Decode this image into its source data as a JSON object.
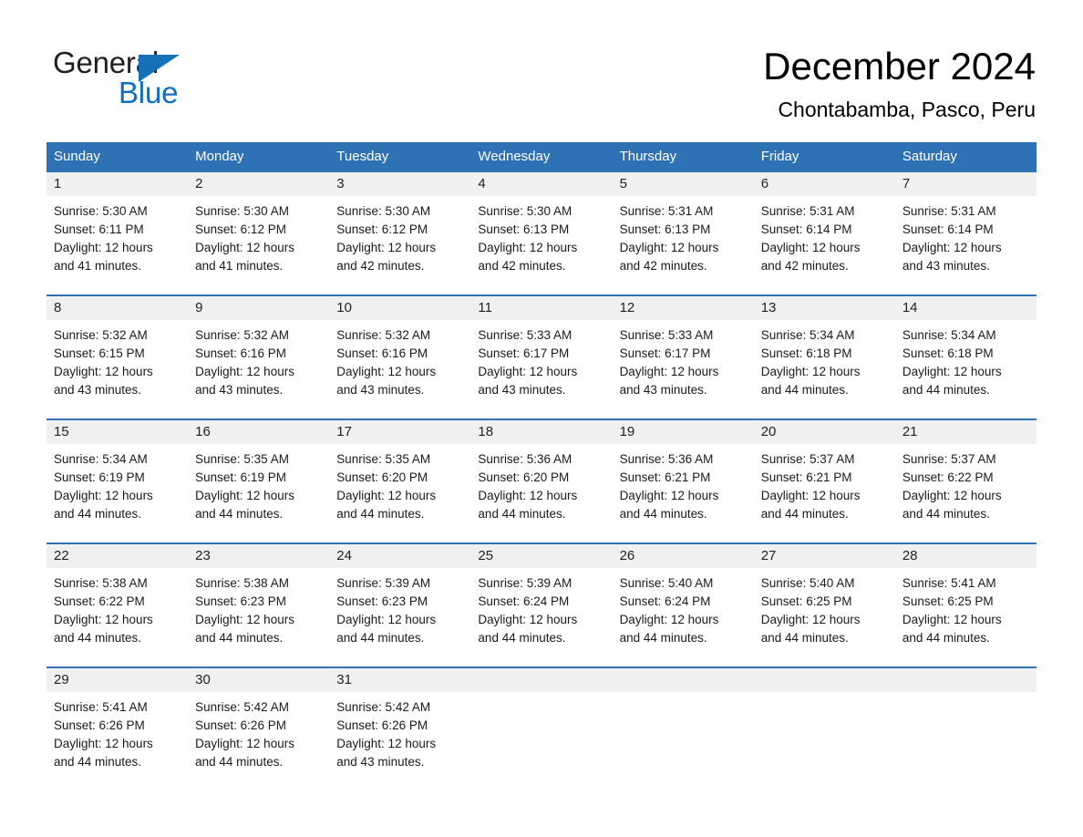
{
  "brand": {
    "name_part1": "General",
    "name_part2": "Blue",
    "triangle_color": "#1570b8",
    "blue_color": "#0f6fc0"
  },
  "header": {
    "title": "December 2024",
    "subtitle": "Chontabamba, Pasco, Peru"
  },
  "theme": {
    "header_blue": "#2e72b5",
    "daynum_gray": "#f0f0f0"
  },
  "weekdays": [
    "Sunday",
    "Monday",
    "Tuesday",
    "Wednesday",
    "Thursday",
    "Friday",
    "Saturday"
  ],
  "weeks": [
    [
      {
        "day": "1",
        "sunrise": "Sunrise: 5:30 AM",
        "sunset": "Sunset: 6:11 PM",
        "daylight_line1": "Daylight: 12 hours",
        "daylight_line2": "and 41 minutes."
      },
      {
        "day": "2",
        "sunrise": "Sunrise: 5:30 AM",
        "sunset": "Sunset: 6:12 PM",
        "daylight_line1": "Daylight: 12 hours",
        "daylight_line2": "and 41 minutes."
      },
      {
        "day": "3",
        "sunrise": "Sunrise: 5:30 AM",
        "sunset": "Sunset: 6:12 PM",
        "daylight_line1": "Daylight: 12 hours",
        "daylight_line2": "and 42 minutes."
      },
      {
        "day": "4",
        "sunrise": "Sunrise: 5:30 AM",
        "sunset": "Sunset: 6:13 PM",
        "daylight_line1": "Daylight: 12 hours",
        "daylight_line2": "and 42 minutes."
      },
      {
        "day": "5",
        "sunrise": "Sunrise: 5:31 AM",
        "sunset": "Sunset: 6:13 PM",
        "daylight_line1": "Daylight: 12 hours",
        "daylight_line2": "and 42 minutes."
      },
      {
        "day": "6",
        "sunrise": "Sunrise: 5:31 AM",
        "sunset": "Sunset: 6:14 PM",
        "daylight_line1": "Daylight: 12 hours",
        "daylight_line2": "and 42 minutes."
      },
      {
        "day": "7",
        "sunrise": "Sunrise: 5:31 AM",
        "sunset": "Sunset: 6:14 PM",
        "daylight_line1": "Daylight: 12 hours",
        "daylight_line2": "and 43 minutes."
      }
    ],
    [
      {
        "day": "8",
        "sunrise": "Sunrise: 5:32 AM",
        "sunset": "Sunset: 6:15 PM",
        "daylight_line1": "Daylight: 12 hours",
        "daylight_line2": "and 43 minutes."
      },
      {
        "day": "9",
        "sunrise": "Sunrise: 5:32 AM",
        "sunset": "Sunset: 6:16 PM",
        "daylight_line1": "Daylight: 12 hours",
        "daylight_line2": "and 43 minutes."
      },
      {
        "day": "10",
        "sunrise": "Sunrise: 5:32 AM",
        "sunset": "Sunset: 6:16 PM",
        "daylight_line1": "Daylight: 12 hours",
        "daylight_line2": "and 43 minutes."
      },
      {
        "day": "11",
        "sunrise": "Sunrise: 5:33 AM",
        "sunset": "Sunset: 6:17 PM",
        "daylight_line1": "Daylight: 12 hours",
        "daylight_line2": "and 43 minutes."
      },
      {
        "day": "12",
        "sunrise": "Sunrise: 5:33 AM",
        "sunset": "Sunset: 6:17 PM",
        "daylight_line1": "Daylight: 12 hours",
        "daylight_line2": "and 43 minutes."
      },
      {
        "day": "13",
        "sunrise": "Sunrise: 5:34 AM",
        "sunset": "Sunset: 6:18 PM",
        "daylight_line1": "Daylight: 12 hours",
        "daylight_line2": "and 44 minutes."
      },
      {
        "day": "14",
        "sunrise": "Sunrise: 5:34 AM",
        "sunset": "Sunset: 6:18 PM",
        "daylight_line1": "Daylight: 12 hours",
        "daylight_line2": "and 44 minutes."
      }
    ],
    [
      {
        "day": "15",
        "sunrise": "Sunrise: 5:34 AM",
        "sunset": "Sunset: 6:19 PM",
        "daylight_line1": "Daylight: 12 hours",
        "daylight_line2": "and 44 minutes."
      },
      {
        "day": "16",
        "sunrise": "Sunrise: 5:35 AM",
        "sunset": "Sunset: 6:19 PM",
        "daylight_line1": "Daylight: 12 hours",
        "daylight_line2": "and 44 minutes."
      },
      {
        "day": "17",
        "sunrise": "Sunrise: 5:35 AM",
        "sunset": "Sunset: 6:20 PM",
        "daylight_line1": "Daylight: 12 hours",
        "daylight_line2": "and 44 minutes."
      },
      {
        "day": "18",
        "sunrise": "Sunrise: 5:36 AM",
        "sunset": "Sunset: 6:20 PM",
        "daylight_line1": "Daylight: 12 hours",
        "daylight_line2": "and 44 minutes."
      },
      {
        "day": "19",
        "sunrise": "Sunrise: 5:36 AM",
        "sunset": "Sunset: 6:21 PM",
        "daylight_line1": "Daylight: 12 hours",
        "daylight_line2": "and 44 minutes."
      },
      {
        "day": "20",
        "sunrise": "Sunrise: 5:37 AM",
        "sunset": "Sunset: 6:21 PM",
        "daylight_line1": "Daylight: 12 hours",
        "daylight_line2": "and 44 minutes."
      },
      {
        "day": "21",
        "sunrise": "Sunrise: 5:37 AM",
        "sunset": "Sunset: 6:22 PM",
        "daylight_line1": "Daylight: 12 hours",
        "daylight_line2": "and 44 minutes."
      }
    ],
    [
      {
        "day": "22",
        "sunrise": "Sunrise: 5:38 AM",
        "sunset": "Sunset: 6:22 PM",
        "daylight_line1": "Daylight: 12 hours",
        "daylight_line2": "and 44 minutes."
      },
      {
        "day": "23",
        "sunrise": "Sunrise: 5:38 AM",
        "sunset": "Sunset: 6:23 PM",
        "daylight_line1": "Daylight: 12 hours",
        "daylight_line2": "and 44 minutes."
      },
      {
        "day": "24",
        "sunrise": "Sunrise: 5:39 AM",
        "sunset": "Sunset: 6:23 PM",
        "daylight_line1": "Daylight: 12 hours",
        "daylight_line2": "and 44 minutes."
      },
      {
        "day": "25",
        "sunrise": "Sunrise: 5:39 AM",
        "sunset": "Sunset: 6:24 PM",
        "daylight_line1": "Daylight: 12 hours",
        "daylight_line2": "and 44 minutes."
      },
      {
        "day": "26",
        "sunrise": "Sunrise: 5:40 AM",
        "sunset": "Sunset: 6:24 PM",
        "daylight_line1": "Daylight: 12 hours",
        "daylight_line2": "and 44 minutes."
      },
      {
        "day": "27",
        "sunrise": "Sunrise: 5:40 AM",
        "sunset": "Sunset: 6:25 PM",
        "daylight_line1": "Daylight: 12 hours",
        "daylight_line2": "and 44 minutes."
      },
      {
        "day": "28",
        "sunrise": "Sunrise: 5:41 AM",
        "sunset": "Sunset: 6:25 PM",
        "daylight_line1": "Daylight: 12 hours",
        "daylight_line2": "and 44 minutes."
      }
    ],
    [
      {
        "day": "29",
        "sunrise": "Sunrise: 5:41 AM",
        "sunset": "Sunset: 6:26 PM",
        "daylight_line1": "Daylight: 12 hours",
        "daylight_line2": "and 44 minutes."
      },
      {
        "day": "30",
        "sunrise": "Sunrise: 5:42 AM",
        "sunset": "Sunset: 6:26 PM",
        "daylight_line1": "Daylight: 12 hours",
        "daylight_line2": "and 44 minutes."
      },
      {
        "day": "31",
        "sunrise": "Sunrise: 5:42 AM",
        "sunset": "Sunset: 6:26 PM",
        "daylight_line1": "Daylight: 12 hours",
        "daylight_line2": "and 43 minutes."
      },
      {
        "day": "",
        "sunrise": "",
        "sunset": "",
        "daylight_line1": "",
        "daylight_line2": ""
      },
      {
        "day": "",
        "sunrise": "",
        "sunset": "",
        "daylight_line1": "",
        "daylight_line2": ""
      },
      {
        "day": "",
        "sunrise": "",
        "sunset": "",
        "daylight_line1": "",
        "daylight_line2": ""
      },
      {
        "day": "",
        "sunrise": "",
        "sunset": "",
        "daylight_line1": "",
        "daylight_line2": ""
      }
    ]
  ]
}
